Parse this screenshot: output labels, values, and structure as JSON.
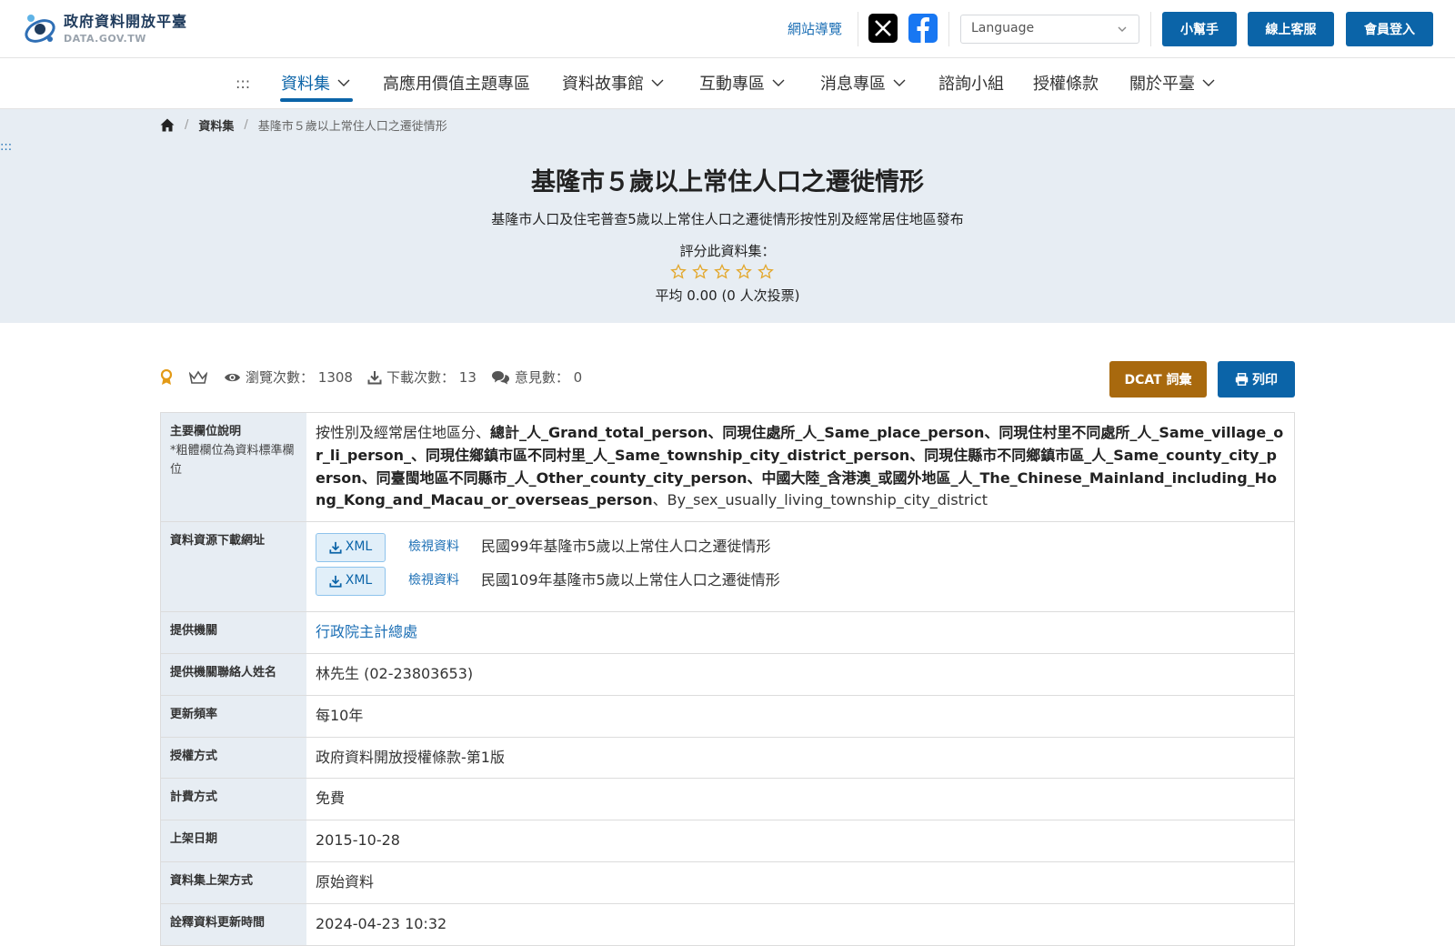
{
  "header": {
    "logo_title": "政府資料開放平臺",
    "logo_sub": "DATA.GOV.TW",
    "sitemap_label": "網站導覽",
    "language_placeholder": "Language",
    "helper_label": "小幫手",
    "support_label": "線上客服",
    "login_label": "會員登入"
  },
  "nav": {
    "accesskey": ":::",
    "items": [
      "資料集",
      "高應用價值主題專區",
      "資料故事館",
      "互動專區",
      "消息專區",
      "諮詢小組",
      "授權條款",
      "關於平臺"
    ]
  },
  "breadcrumb": {
    "level1": "資料集",
    "current": "基隆市５歲以上常住人口之遷徙情形"
  },
  "hero": {
    "accesskey": ":::",
    "title": "基隆市５歲以上常住人口之遷徙情形",
    "description": "基隆市人口及住宅普查5歲以上常住人口之遷徙情形按性別及經常居住地區發布",
    "rate_label": "評分此資料集：",
    "rating_value": 0,
    "rating_max": 5,
    "rating_avg": "平均 0.00 (0 人次投票)"
  },
  "stats": {
    "views_label": "瀏覽次數：",
    "views": "1308",
    "downloads_label": "下載次數：",
    "downloads": "13",
    "comments_label": "意見數：",
    "comments": "0",
    "dcat_label": "DCAT 詞彙",
    "print_label": "列印"
  },
  "detail": {
    "fields_label": "主要欄位說明",
    "fields_note": "*粗體欄位為資料標準欄位",
    "fields_prefix": "按性別及經常居住地區分、",
    "fields_bold": "總計_人_Grand_total_person、同現住處所_人_Same_place_person、同現住村里不同處所_人_Same_village_or_li_person_、同現住鄉鎮市區不同村里_人_Same_township_city_district_person、同現住縣市不同鄉鎮市區_人_Same_county_city_person、同臺閩地區不同縣市_人_Other_county_city_person、中國大陸_含港澳_或國外地區_人_The_Chinese_Mainland_including_Hong_Kong_and_Macau_or_overseas_person",
    "fields_suffix": "、By_sex_usually_living_township_city_district",
    "resources_label": "資料資源下載網址",
    "resources": [
      {
        "format": "XML",
        "view": "檢視資料",
        "name": "民國99年基隆市5歲以上常住人口之遷徙情形"
      },
      {
        "format": "XML",
        "view": "檢視資料",
        "name": "民國109年基隆市5歲以上常住人口之遷徙情形"
      }
    ],
    "agency_label": "提供機關",
    "agency": "行政院主計總處",
    "contact_label": "提供機關聯絡人姓名",
    "contact": "林先生 (02-23803653)",
    "frequency_label": "更新頻率",
    "frequency": "每10年",
    "license_label": "授權方式",
    "license": "政府資料開放授權條款-第1版",
    "fee_label": "計費方式",
    "fee": "免費",
    "publish_label": "上架日期",
    "publish": "2015-10-28",
    "method_label": "資料集上架方式",
    "method": "原始資料",
    "updated_label": "詮釋資料更新時間",
    "updated": "2024-04-23 10:32"
  }
}
